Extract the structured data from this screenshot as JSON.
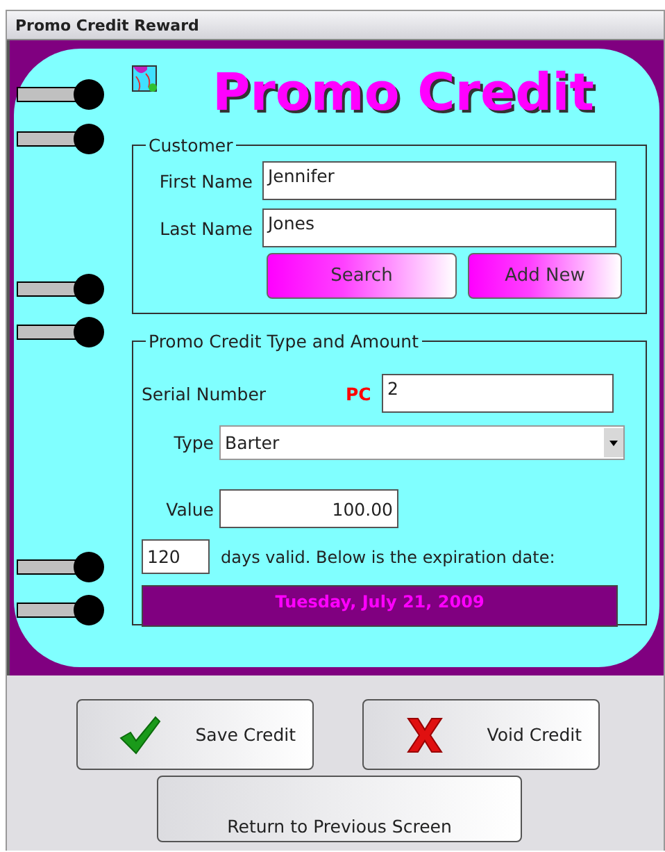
{
  "window": {
    "title": "Promo Credit Reward"
  },
  "heading": "Promo Credit",
  "customer": {
    "legend": "Customer",
    "fields": [
      {
        "label": "First Name",
        "value": "Jennifer"
      },
      {
        "label": "Last Name",
        "value": "Jones"
      }
    ],
    "buttons": [
      "Search",
      "Add New"
    ]
  },
  "credit": {
    "legend": "Promo Credit Type and Amount",
    "serial": {
      "label": "Serial Number",
      "prefix": "PC",
      "value": "2"
    },
    "type": {
      "label": "Type",
      "value": "Barter"
    },
    "value": {
      "label": "Value",
      "value": "100.00"
    },
    "days": {
      "value": "120",
      "text": "days valid. Below is the expiration date:"
    },
    "expiration": "Tuesday, July 21, 2009"
  },
  "actions": [
    {
      "kind": "check",
      "label": "Save Credit"
    },
    {
      "kind": "cross",
      "label": "Void Credit"
    },
    {
      "kind": "plain",
      "label": "Return to Previous Screen"
    }
  ]
}
